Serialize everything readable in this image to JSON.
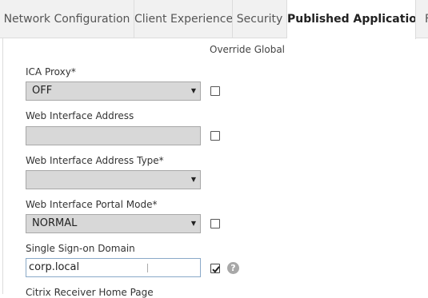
{
  "tabs": [
    {
      "label": "Network Configuration"
    },
    {
      "label": "Client Experience"
    },
    {
      "label": "Security"
    },
    {
      "label": "Published Applications"
    },
    {
      "label": "F"
    }
  ],
  "override_header": "Override Global",
  "form": {
    "ica_proxy": {
      "label": "ICA Proxy*",
      "value": "OFF",
      "override_checked": false
    },
    "web_interface_address": {
      "label": "Web Interface Address",
      "value": "",
      "override_checked": false
    },
    "web_interface_address_type": {
      "label": "Web Interface Address Type*",
      "value": ""
    },
    "web_interface_portal_mode": {
      "label": "Web Interface Portal Mode*",
      "value": "NORMAL",
      "override_checked": false
    },
    "single_sign_on_domain": {
      "label": "Single Sign-on Domain",
      "value": "corp.local",
      "override_checked": true,
      "help": "?"
    },
    "citrix_receiver_home_page": {
      "label": "Citrix Receiver Home Page"
    }
  },
  "icons": {
    "dropdown": "chevron-down-icon",
    "help": "question-icon",
    "check": "checkmark-icon"
  }
}
